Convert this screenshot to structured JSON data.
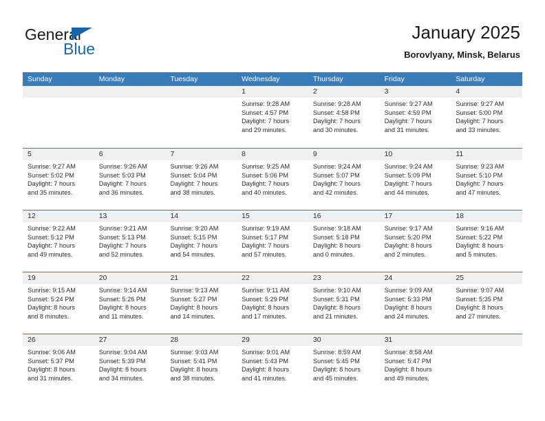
{
  "brand": {
    "name_part1": "General",
    "name_part2": "Blue",
    "flag_icon": "flag-icon",
    "accent_color": "#1668ad"
  },
  "header": {
    "title": "January 2025",
    "subtitle": "Borovlyany, Minsk, Belarus"
  },
  "theme": {
    "header_row_bg": "#3b7cb8",
    "day_head_bg": "#f0f0f0",
    "text_color": "#2b2b2b",
    "cell_bg": "#ffffff"
  },
  "calendar": {
    "weekdays": [
      "Sunday",
      "Monday",
      "Tuesday",
      "Wednesday",
      "Thursday",
      "Friday",
      "Saturday"
    ],
    "weeks": [
      [
        {
          "day": "",
          "sunrise": "",
          "sunset": "",
          "daylight_line1": "",
          "daylight_line2": ""
        },
        {
          "day": "",
          "sunrise": "",
          "sunset": "",
          "daylight_line1": "",
          "daylight_line2": ""
        },
        {
          "day": "",
          "sunrise": "",
          "sunset": "",
          "daylight_line1": "",
          "daylight_line2": ""
        },
        {
          "day": "1",
          "sunrise": "Sunrise: 9:28 AM",
          "sunset": "Sunset: 4:57 PM",
          "daylight_line1": "Daylight: 7 hours",
          "daylight_line2": "and 29 minutes."
        },
        {
          "day": "2",
          "sunrise": "Sunrise: 9:28 AM",
          "sunset": "Sunset: 4:58 PM",
          "daylight_line1": "Daylight: 7 hours",
          "daylight_line2": "and 30 minutes."
        },
        {
          "day": "3",
          "sunrise": "Sunrise: 9:27 AM",
          "sunset": "Sunset: 4:59 PM",
          "daylight_line1": "Daylight: 7 hours",
          "daylight_line2": "and 31 minutes."
        },
        {
          "day": "4",
          "sunrise": "Sunrise: 9:27 AM",
          "sunset": "Sunset: 5:00 PM",
          "daylight_line1": "Daylight: 7 hours",
          "daylight_line2": "and 33 minutes."
        }
      ],
      [
        {
          "day": "5",
          "sunrise": "Sunrise: 9:27 AM",
          "sunset": "Sunset: 5:02 PM",
          "daylight_line1": "Daylight: 7 hours",
          "daylight_line2": "and 35 minutes."
        },
        {
          "day": "6",
          "sunrise": "Sunrise: 9:26 AM",
          "sunset": "Sunset: 5:03 PM",
          "daylight_line1": "Daylight: 7 hours",
          "daylight_line2": "and 36 minutes."
        },
        {
          "day": "7",
          "sunrise": "Sunrise: 9:26 AM",
          "sunset": "Sunset: 5:04 PM",
          "daylight_line1": "Daylight: 7 hours",
          "daylight_line2": "and 38 minutes."
        },
        {
          "day": "8",
          "sunrise": "Sunrise: 9:25 AM",
          "sunset": "Sunset: 5:06 PM",
          "daylight_line1": "Daylight: 7 hours",
          "daylight_line2": "and 40 minutes."
        },
        {
          "day": "9",
          "sunrise": "Sunrise: 9:24 AM",
          "sunset": "Sunset: 5:07 PM",
          "daylight_line1": "Daylight: 7 hours",
          "daylight_line2": "and 42 minutes."
        },
        {
          "day": "10",
          "sunrise": "Sunrise: 9:24 AM",
          "sunset": "Sunset: 5:09 PM",
          "daylight_line1": "Daylight: 7 hours",
          "daylight_line2": "and 44 minutes."
        },
        {
          "day": "11",
          "sunrise": "Sunrise: 9:23 AM",
          "sunset": "Sunset: 5:10 PM",
          "daylight_line1": "Daylight: 7 hours",
          "daylight_line2": "and 47 minutes."
        }
      ],
      [
        {
          "day": "12",
          "sunrise": "Sunrise: 9:22 AM",
          "sunset": "Sunset: 5:12 PM",
          "daylight_line1": "Daylight: 7 hours",
          "daylight_line2": "and 49 minutes."
        },
        {
          "day": "13",
          "sunrise": "Sunrise: 9:21 AM",
          "sunset": "Sunset: 5:13 PM",
          "daylight_line1": "Daylight: 7 hours",
          "daylight_line2": "and 52 minutes."
        },
        {
          "day": "14",
          "sunrise": "Sunrise: 9:20 AM",
          "sunset": "Sunset: 5:15 PM",
          "daylight_line1": "Daylight: 7 hours",
          "daylight_line2": "and 54 minutes."
        },
        {
          "day": "15",
          "sunrise": "Sunrise: 9:19 AM",
          "sunset": "Sunset: 5:17 PM",
          "daylight_line1": "Daylight: 7 hours",
          "daylight_line2": "and 57 minutes."
        },
        {
          "day": "16",
          "sunrise": "Sunrise: 9:18 AM",
          "sunset": "Sunset: 5:18 PM",
          "daylight_line1": "Daylight: 8 hours",
          "daylight_line2": "and 0 minutes."
        },
        {
          "day": "17",
          "sunrise": "Sunrise: 9:17 AM",
          "sunset": "Sunset: 5:20 PM",
          "daylight_line1": "Daylight: 8 hours",
          "daylight_line2": "and 2 minutes."
        },
        {
          "day": "18",
          "sunrise": "Sunrise: 9:16 AM",
          "sunset": "Sunset: 5:22 PM",
          "daylight_line1": "Daylight: 8 hours",
          "daylight_line2": "and 5 minutes."
        }
      ],
      [
        {
          "day": "19",
          "sunrise": "Sunrise: 9:15 AM",
          "sunset": "Sunset: 5:24 PM",
          "daylight_line1": "Daylight: 8 hours",
          "daylight_line2": "and 8 minutes."
        },
        {
          "day": "20",
          "sunrise": "Sunrise: 9:14 AM",
          "sunset": "Sunset: 5:26 PM",
          "daylight_line1": "Daylight: 8 hours",
          "daylight_line2": "and 11 minutes."
        },
        {
          "day": "21",
          "sunrise": "Sunrise: 9:13 AM",
          "sunset": "Sunset: 5:27 PM",
          "daylight_line1": "Daylight: 8 hours",
          "daylight_line2": "and 14 minutes."
        },
        {
          "day": "22",
          "sunrise": "Sunrise: 9:11 AM",
          "sunset": "Sunset: 5:29 PM",
          "daylight_line1": "Daylight: 8 hours",
          "daylight_line2": "and 17 minutes."
        },
        {
          "day": "23",
          "sunrise": "Sunrise: 9:10 AM",
          "sunset": "Sunset: 5:31 PM",
          "daylight_line1": "Daylight: 8 hours",
          "daylight_line2": "and 21 minutes."
        },
        {
          "day": "24",
          "sunrise": "Sunrise: 9:09 AM",
          "sunset": "Sunset: 5:33 PM",
          "daylight_line1": "Daylight: 8 hours",
          "daylight_line2": "and 24 minutes."
        },
        {
          "day": "25",
          "sunrise": "Sunrise: 9:07 AM",
          "sunset": "Sunset: 5:35 PM",
          "daylight_line1": "Daylight: 8 hours",
          "daylight_line2": "and 27 minutes."
        }
      ],
      [
        {
          "day": "26",
          "sunrise": "Sunrise: 9:06 AM",
          "sunset": "Sunset: 5:37 PM",
          "daylight_line1": "Daylight: 8 hours",
          "daylight_line2": "and 31 minutes."
        },
        {
          "day": "27",
          "sunrise": "Sunrise: 9:04 AM",
          "sunset": "Sunset: 5:39 PM",
          "daylight_line1": "Daylight: 8 hours",
          "daylight_line2": "and 34 minutes."
        },
        {
          "day": "28",
          "sunrise": "Sunrise: 9:03 AM",
          "sunset": "Sunset: 5:41 PM",
          "daylight_line1": "Daylight: 8 hours",
          "daylight_line2": "and 38 minutes."
        },
        {
          "day": "29",
          "sunrise": "Sunrise: 9:01 AM",
          "sunset": "Sunset: 5:43 PM",
          "daylight_line1": "Daylight: 8 hours",
          "daylight_line2": "and 41 minutes."
        },
        {
          "day": "30",
          "sunrise": "Sunrise: 8:59 AM",
          "sunset": "Sunset: 5:45 PM",
          "daylight_line1": "Daylight: 8 hours",
          "daylight_line2": "and 45 minutes."
        },
        {
          "day": "31",
          "sunrise": "Sunrise: 8:58 AM",
          "sunset": "Sunset: 5:47 PM",
          "daylight_line1": "Daylight: 8 hours",
          "daylight_line2": "and 49 minutes."
        },
        {
          "day": "",
          "sunrise": "",
          "sunset": "",
          "daylight_line1": "",
          "daylight_line2": ""
        }
      ]
    ]
  }
}
